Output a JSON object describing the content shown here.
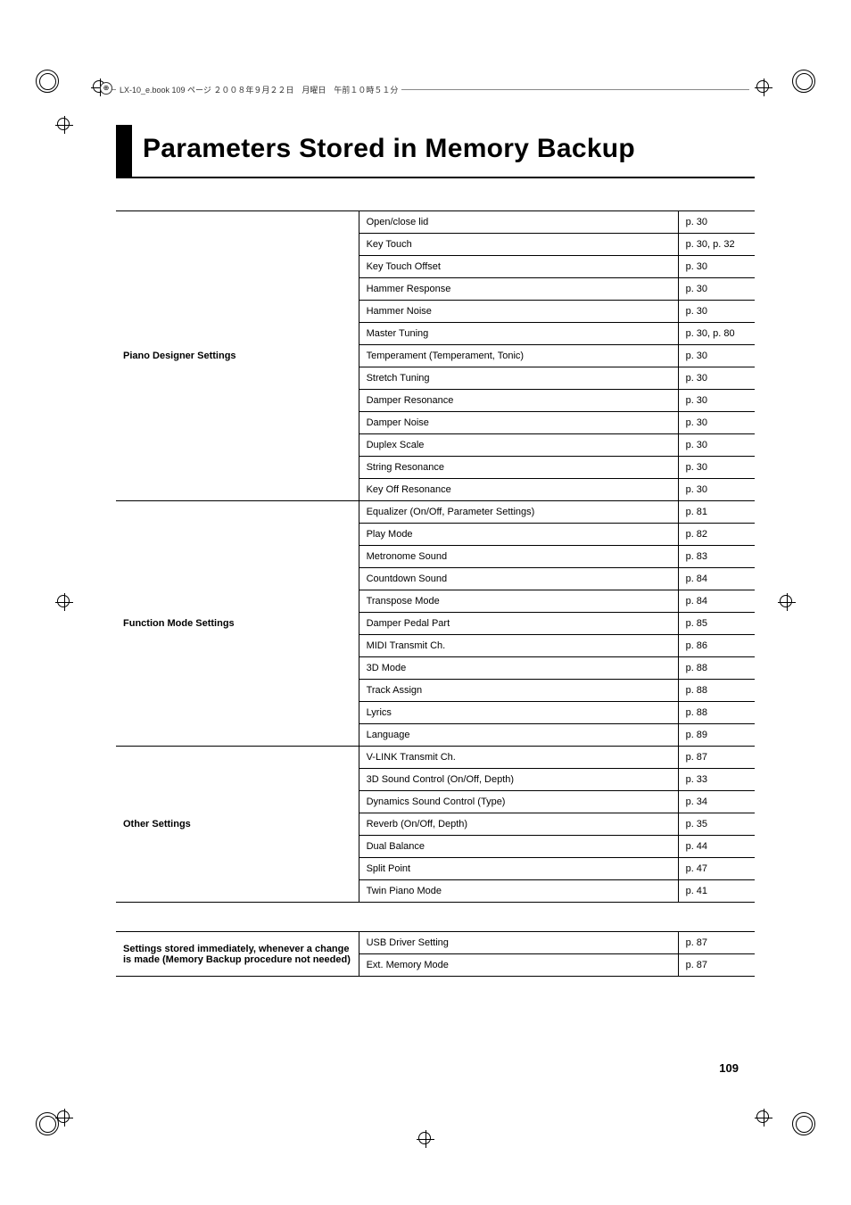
{
  "header": {
    "text": "LX-10_e.book  109 ページ  ２００８年９月２２日　月曜日　午前１０時５１分"
  },
  "title": "Parameters Stored in Memory Backup",
  "page_number": "109",
  "table1": {
    "groups": [
      {
        "category": "Piano Designer Settings",
        "rows": [
          {
            "param": "Open/close lid",
            "page": "p. 30"
          },
          {
            "param": "Key Touch",
            "page": "p. 30, p. 32"
          },
          {
            "param": "Key Touch Offset",
            "page": "p. 30"
          },
          {
            "param": "Hammer Response",
            "page": "p. 30"
          },
          {
            "param": "Hammer Noise",
            "page": "p. 30"
          },
          {
            "param": "Master Tuning",
            "page": "p. 30, p. 80"
          },
          {
            "param": "Temperament (Temperament, Tonic)",
            "page": "p. 30"
          },
          {
            "param": "Stretch Tuning",
            "page": "p. 30"
          },
          {
            "param": "Damper Resonance",
            "page": "p. 30"
          },
          {
            "param": "Damper Noise",
            "page": "p. 30"
          },
          {
            "param": "Duplex Scale",
            "page": "p. 30"
          },
          {
            "param": "String Resonance",
            "page": "p. 30"
          },
          {
            "param": "Key Off Resonance",
            "page": "p. 30"
          }
        ]
      },
      {
        "category": "Function Mode Settings",
        "rows": [
          {
            "param": "Equalizer (On/Off, Parameter Settings)",
            "page": "p. 81"
          },
          {
            "param": "Play Mode",
            "page": "p. 82"
          },
          {
            "param": "Metronome Sound",
            "page": "p. 83"
          },
          {
            "param": "Countdown Sound",
            "page": "p. 84"
          },
          {
            "param": "Transpose Mode",
            "page": "p. 84"
          },
          {
            "param": "Damper Pedal Part",
            "page": "p. 85"
          },
          {
            "param": "MIDI Transmit Ch.",
            "page": "p. 86"
          },
          {
            "param": "3D Mode",
            "page": "p. 88"
          },
          {
            "param": "Track Assign",
            "page": "p. 88"
          },
          {
            "param": "Lyrics",
            "page": "p. 88"
          },
          {
            "param": "Language",
            "page": "p. 89"
          }
        ]
      },
      {
        "category": "Other Settings",
        "rows": [
          {
            "param": "V-LINK Transmit Ch.",
            "page": "p. 87"
          },
          {
            "param": "3D Sound Control (On/Off, Depth)",
            "page": "p. 33"
          },
          {
            "param": "Dynamics Sound Control (Type)",
            "page": "p. 34"
          },
          {
            "param": "Reverb (On/Off, Depth)",
            "page": "p. 35"
          },
          {
            "param": "Dual Balance",
            "page": "p. 44"
          },
          {
            "param": "Split Point",
            "page": "p. 47"
          },
          {
            "param": "Twin Piano Mode",
            "page": "p. 41"
          }
        ]
      }
    ]
  },
  "table2": {
    "category": "Settings stored immediately, whenever a change is made (Memory Backup procedure not needed)",
    "rows": [
      {
        "param": "USB Driver Setting",
        "page": "p. 87"
      },
      {
        "param": "Ext. Memory Mode",
        "page": "p. 87"
      }
    ]
  }
}
